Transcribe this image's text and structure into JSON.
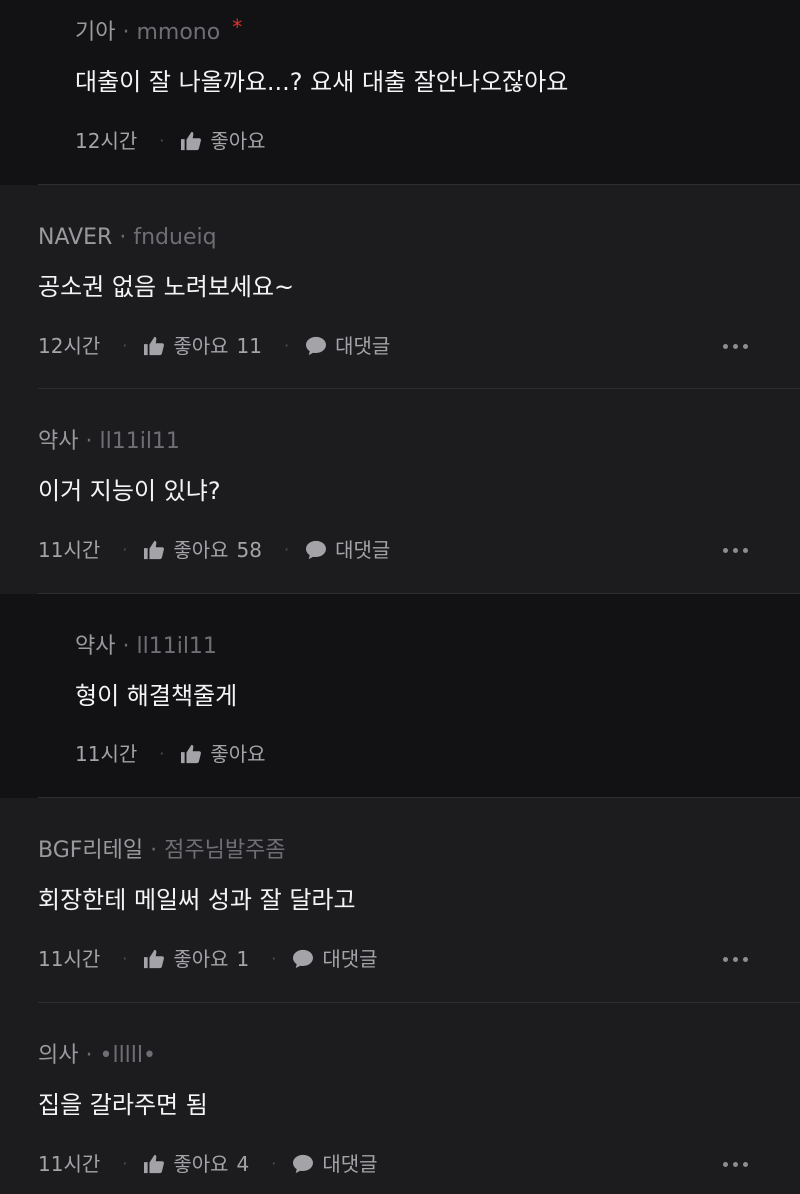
{
  "comments": [
    {
      "company": "기아",
      "separator": "·",
      "nickname": "mmono",
      "badge": "*",
      "text": "대출이 잘 나올까요...? 요새 대출 잘안나오잖아요",
      "time": "12시간",
      "like_label": "좋아요",
      "like_count": ""
    },
    {
      "company": "NAVER",
      "separator": "·",
      "nickname": "fndueiq",
      "text": "공소권 없음 노려보세요~",
      "time": "12시간",
      "like_label": "좋아요",
      "like_count": "11",
      "reply_label": "대댓글"
    },
    {
      "company": "약사",
      "separator": "·",
      "nickname": "ll11il11",
      "text": "이거 지능이 있냐?",
      "time": "11시간",
      "like_label": "좋아요",
      "like_count": "58",
      "reply_label": "대댓글"
    },
    {
      "company": "약사",
      "separator": "·",
      "nickname": "ll11il11",
      "text": "형이 해결책줄게",
      "time": "11시간",
      "like_label": "좋아요",
      "like_count": ""
    },
    {
      "company": "BGF리테일",
      "separator": "·",
      "nickname": "점주님발주좀",
      "text": "회장한테 메일써 성과 잘 달라고",
      "time": "11시간",
      "like_label": "좋아요",
      "like_count": "1",
      "reply_label": "대댓글"
    },
    {
      "company": "의사",
      "separator": "·",
      "nickname": "•lllll•",
      "text": "집을 갈라주면 됨",
      "time": "11시간",
      "like_label": "좋아요",
      "like_count": "4",
      "reply_label": "대댓글"
    }
  ],
  "icons": {
    "like": "thumbs-up-icon",
    "reply": "speech-bubble-icon",
    "more": "more-horizontal-icon"
  },
  "colors": {
    "background": "#1c1c1e",
    "reply_background": "#121214",
    "badge": "#e0322b",
    "divider": "#2e2e31"
  }
}
